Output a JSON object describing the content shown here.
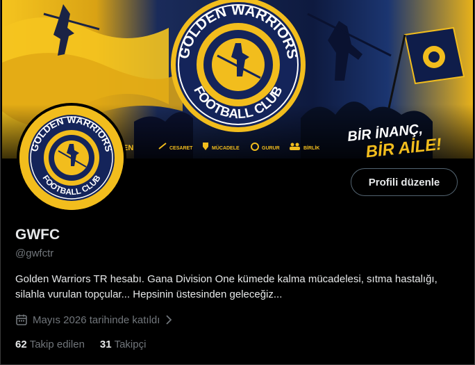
{
  "banner": {
    "crest_top": "GOLDEN WARRIORS",
    "crest_bottom": "FOOTBALL CLUB",
    "values": [
      "CESARET",
      "MÜCADELE",
      "GURUR",
      "BİRLİK"
    ],
    "slogan_line1": "BİR İNANÇ,",
    "slogan_line2": "BİR AİLE!",
    "partial_text": "EN"
  },
  "avatar": {
    "crest_top": "GOLDEN WARRIORS",
    "crest_bottom": "FOOTBALL CLUB"
  },
  "profile": {
    "edit_label": "Profili düzenle",
    "name": "GWFC",
    "handle": "@gwfctr",
    "bio": "Golden Warriors TR hesabı. Gana Division One kümede kalma mücadelesi, sıtma hastalığı, silahla vurulan topçular... Hepsinin üstesinden geleceğiz...",
    "joined": "Mayıs 2026 tarihinde katıldı",
    "following_count": "62",
    "following_label": "Takip edilen",
    "followers_count": "31",
    "followers_label": "Takipçi"
  },
  "colors": {
    "gold": "#f2bd1d",
    "navy": "#14245a",
    "muted": "#71767b"
  },
  "icons": [
    "calendar-icon",
    "chevron-right-icon",
    "sword-icon",
    "shield-icon",
    "sun-icon",
    "people-icon"
  ]
}
